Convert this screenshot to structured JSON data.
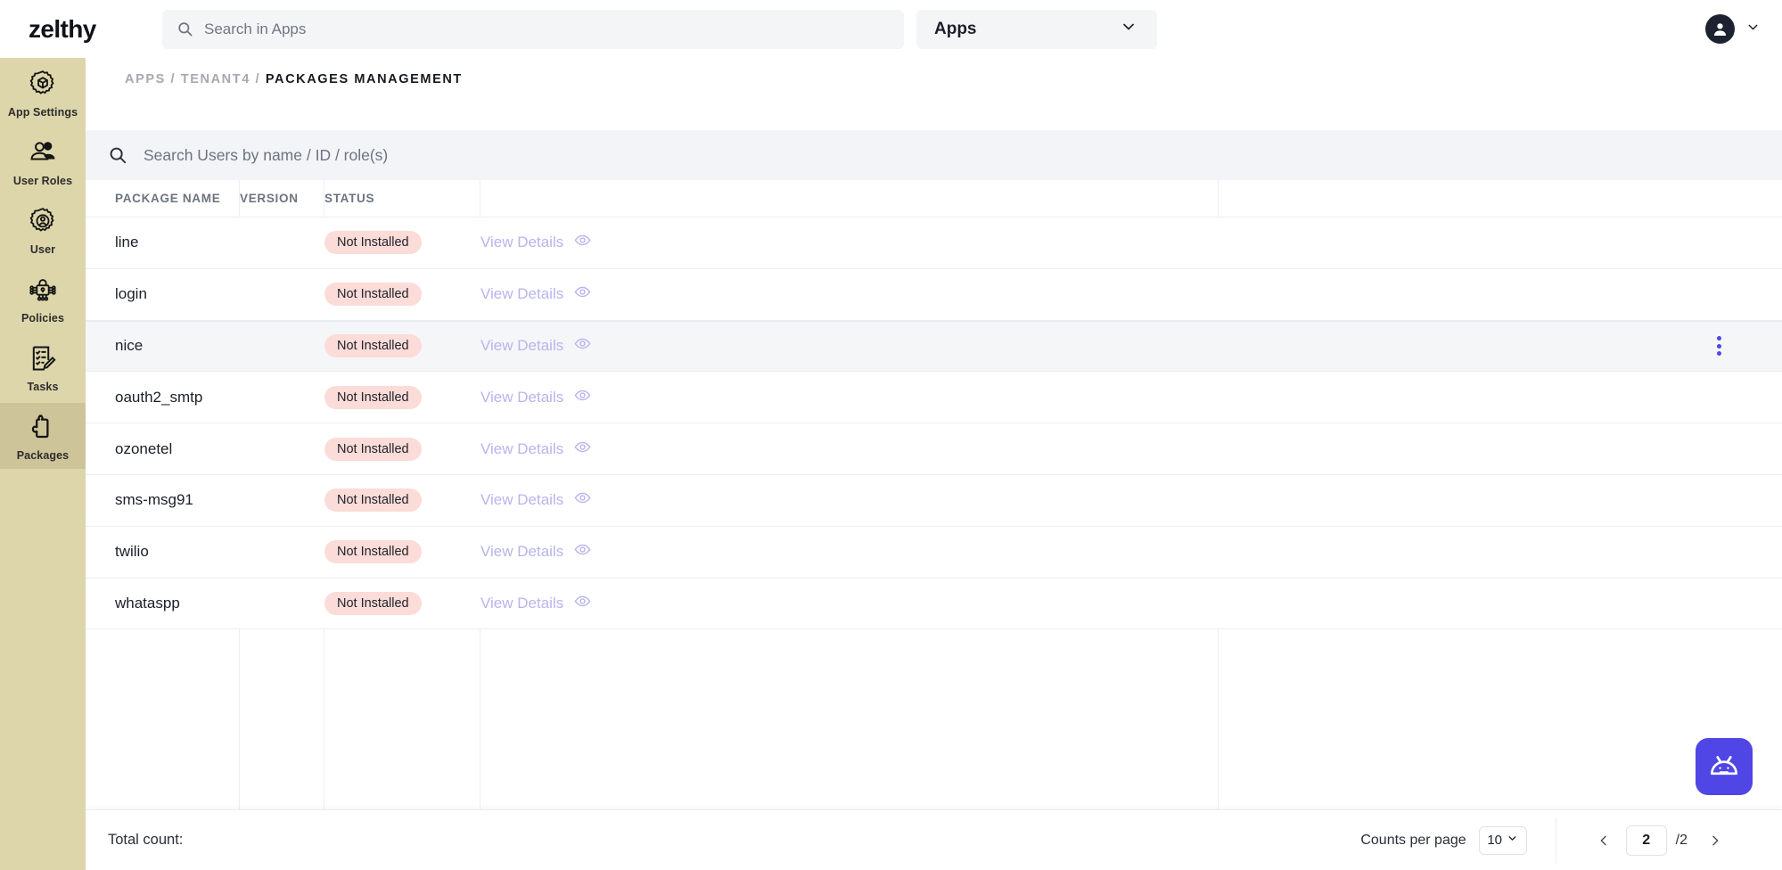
{
  "topbar": {
    "brand": "zelthy",
    "search_placeholder": "Search in Apps",
    "search_icon": "search-icon",
    "apps_select_label": "Apps",
    "apps_chevron_icon": "chevron-down-icon",
    "avatar_icon": "user-avatar-icon",
    "avatar_chevron_icon": "chevron-down-icon"
  },
  "sidebar": {
    "items": [
      {
        "label": "App Settings",
        "icon": "gear-box-icon",
        "active": false
      },
      {
        "label": "User Roles",
        "icon": "user-roles-icon",
        "active": false
      },
      {
        "label": "User",
        "icon": "user-gear-icon",
        "active": false
      },
      {
        "label": "Policies",
        "icon": "policy-lock-icon",
        "active": false
      },
      {
        "label": "Tasks",
        "icon": "tasks-checklist-icon",
        "active": false
      },
      {
        "label": "Packages",
        "icon": "puzzle-piece-icon",
        "active": true
      }
    ]
  },
  "breadcrumb": {
    "apps": "APPS",
    "sep1": "/",
    "tenant": "TENANT4",
    "sep2": "/",
    "current": "PACKAGES MANAGEMENT"
  },
  "user_search": {
    "placeholder": "Search Users by name / ID / role(s)",
    "icon": "search-icon"
  },
  "table": {
    "headers": {
      "name": "PACKAGE NAME",
      "version": "VERSION",
      "status": "STATUS"
    },
    "view_details_label": "View Details",
    "eye_icon": "eye-icon",
    "kebab_icon": "more-vertical-icon",
    "rows": [
      {
        "name": "line",
        "version": "",
        "status": "Not Installed",
        "hovered": false
      },
      {
        "name": "login",
        "version": "",
        "status": "Not Installed",
        "hovered": false
      },
      {
        "name": "nice",
        "version": "",
        "status": "Not Installed",
        "hovered": true
      },
      {
        "name": "oauth2_smtp",
        "version": "",
        "status": "Not Installed",
        "hovered": false
      },
      {
        "name": "ozonetel",
        "version": "",
        "status": "Not Installed",
        "hovered": false
      },
      {
        "name": "sms-msg91",
        "version": "",
        "status": "Not Installed",
        "hovered": false
      },
      {
        "name": "twilio",
        "version": "",
        "status": "Not Installed",
        "hovered": false
      },
      {
        "name": "whataspp",
        "version": "",
        "status": "Not Installed",
        "hovered": false
      }
    ]
  },
  "footer": {
    "total_count_label": "Total count:",
    "total_count_value": "",
    "counts_per_page_label": "Counts per page",
    "counts_per_page_value": "10",
    "counts_chevron_icon": "chevron-down-icon",
    "prev_icon": "chevron-left-icon",
    "next_icon": "chevron-right-icon",
    "current_page": "2",
    "total_pages": "/2"
  },
  "chatbot": {
    "icon": "robot-icon"
  },
  "colors": {
    "sidebar_bg": "#ddd6ab",
    "sidebar_active_bg": "#cec49a",
    "badge_bg": "#fbdcd8",
    "accent_purple": "#4f46e5",
    "link_purple": "#b7b4ee",
    "search_bg": "#f2f4f7"
  }
}
